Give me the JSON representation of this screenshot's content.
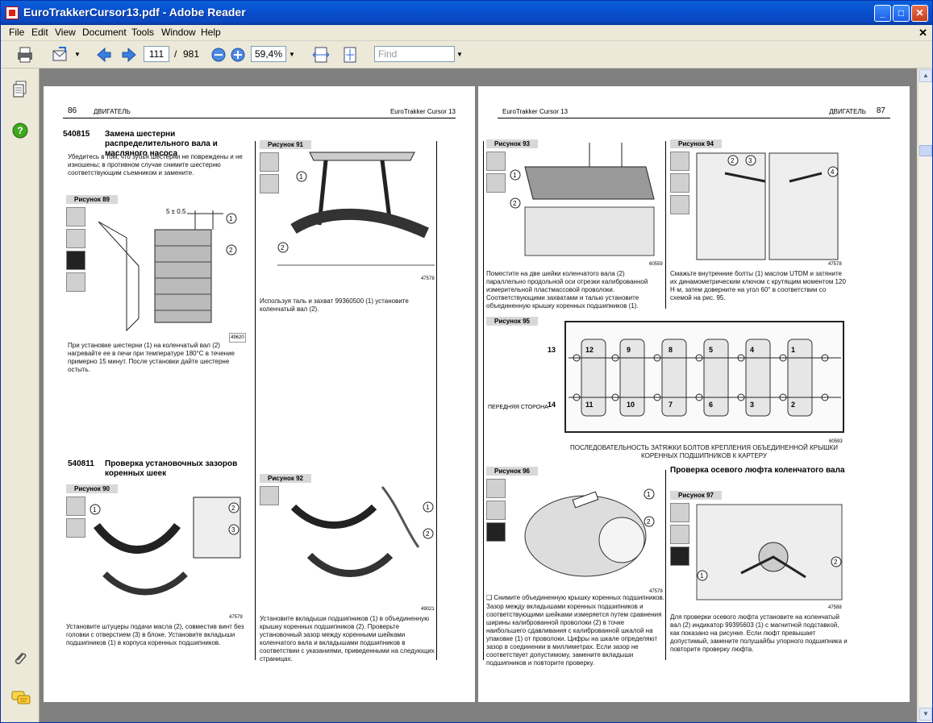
{
  "window": {
    "title": "EuroTrakkerCursor13.pdf - Adobe Reader"
  },
  "menu": [
    "File",
    "Edit",
    "View",
    "Document",
    "Tools",
    "Window",
    "Help"
  ],
  "toolbar": {
    "page_current": "111",
    "page_sep": "/",
    "page_total": "981",
    "zoom": "59,4%",
    "find_placeholder": "Find"
  },
  "colors": {
    "titlebar": "#0a5fd8",
    "viewer_bg": "#808080",
    "accent": "#ff9900"
  },
  "left_page": {
    "page_num": "86",
    "header_left": "ДВИГАТЕЛЬ",
    "header_right": "EuroTrakker Cursor 13",
    "sec1_code": "540815",
    "sec1_title": "Замена шестерни распределительного вала и масляного насоса",
    "sec1_text": "Убедитесь в том, что зубья шестерни не повреждены и не изношены; в противном случае снимите шестерню соответствующим съемником и замените.",
    "fig89": "Рисунок 89",
    "fig89_dim": "5 ± 0.5",
    "fig89_code": "49620",
    "fig89_text": "При установке шестерни (1) на коленчатый вал (2) нагревайте ее в печи при температуре 180°C в течение примерно 15 минут. После установки дайте шестерне остыть.",
    "fig91": "Рисунок 91",
    "fig91_code": "47578",
    "fig91_text": "Используя таль и захват 99360500 (1) установите коленчатый вал (2).",
    "sec2_code": "540811",
    "sec2_title": "Проверка установочных зазоров коренных шеек",
    "fig90": "Рисунок 90",
    "fig90_code": "47579",
    "fig90_text": "Установите штуцеры подачи масла (2), совместив винт без головки с отверстием (3) в блоке. Установите вкладыши подшипников (1) в корпуса коренных подшипников.",
    "fig92": "Рисунок 92",
    "fig92_code": "49021",
    "fig92_text": "Установите вкладыши подшипников (1) в объединенную крышку коренных подшипников (2). Проверьте установочный зазор между коренными шейками коленчатого вала и вкладышами подшипников в соответствии с указаниями, приведенными на следующих страницах."
  },
  "right_page": {
    "page_num": "87",
    "header_left": "EuroTrakker Cursor 13",
    "header_right": "ДВИГАТЕЛЬ",
    "fig93": "Рисунок 93",
    "fig93_code": "60559",
    "fig93_text": "Поместите на две шейки коленчатого вала (2) параллельно продольной оси отрезки калиброванной измерительной пластмассовой проволоки. Соответствующими захватами и талью установите объединенную крышку коренных подшипников (1).",
    "fig94": "Рисунок 94",
    "fig94_code": "47578",
    "fig94_text": "Смажьте внутренние болты (1) маслом UTDM и затяните их динамометрическим ключом с крутящим моментом 120 Н·м, затем доверните на угол 60° в соответствии со схемой на рис. 95.",
    "fig95": "Рисунок 95",
    "fig95_code": "60593",
    "fig95_front": "ПЕРЕДНЯЯ СТОРОНА",
    "fig95_caption": "ПОСЛЕДОВАТЕЛЬНОСТЬ ЗАТЯЖКИ БОЛТОВ КРЕПЛЕНИЯ ОБЪЕДИНЕННОЙ КРЫШКИ КОРЕННЫХ ПОДШИПНИКОВ К КАРТЕРУ",
    "fig95_top_nums": [
      "13",
      "12",
      "9",
      "8",
      "5",
      "4",
      "1"
    ],
    "fig95_bottom_nums": [
      "14",
      "11",
      "10",
      "7",
      "6",
      "3",
      "2"
    ],
    "fig96": "Рисунок 96",
    "fig96_code": "47579",
    "fig96_text1": "Снимите объединенную крышку коренных подшипников.",
    "fig96_text2": "Зазор между вкладышами коренных подшипников и соответствующими шейками измеряется путем сравнения ширины калиброванной проволоки (2) в точке наибольшего сдавливания с калиброванной шкалой на упаковке (1) от проволоки. Цифры на шкале определяют зазор в соединении в миллиметрах. Если зазор не соответствует допустимому, замените вкладыши подшипников и повторите проверку.",
    "sec3_title": "Проверка осевого люфта коленчатого вала",
    "fig97": "Рисунок 97",
    "fig97_code": "47588",
    "fig97_text": "Для проверки осевого люфта установите на коленчатый вал (2) индикатор 99395603 (1) с магнитной подставкой, как показано на рисунке. Если люфт превышает допустимый, замените полушайбы упорного подшипника и повторите проверку люфта."
  }
}
